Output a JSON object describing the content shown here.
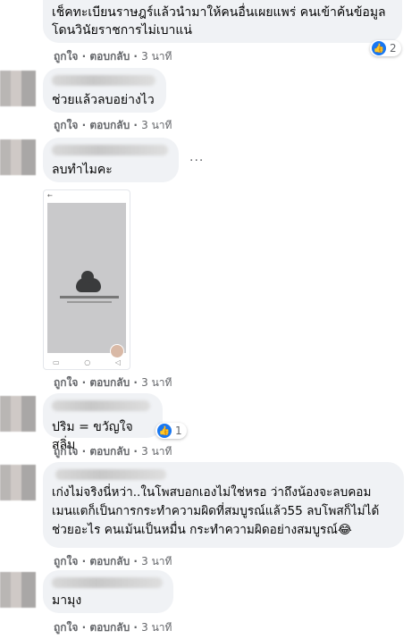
{
  "comments": [
    {
      "text": "เช็คทะเบียนราษฎร์แล้วนำมาให้คนอื่นเผยแพร่ คนเข้าค้นข้อมูล\nโดนวินัยราชการไม่เบาแน่",
      "like": "ถูกใจ",
      "reply": "ตอบกลับ",
      "time": "3 นาที",
      "reactions": "2"
    },
    {
      "text": "ช่วยแล้วลบอย่างไว",
      "like": "ถูกใจ",
      "reply": "ตอบกลับ",
      "time": "3 นาที"
    },
    {
      "text": "ลบทำไมคะ",
      "like": "ถูกใจ",
      "reply": "ตอบกลับ",
      "time": "3 นาที"
    },
    {
      "text": "ปริม = ขวัญใจสลิ่ม",
      "like": "ถูกใจ",
      "reply": "ตอบกลับ",
      "time": "3 นาที",
      "reactions": "1"
    },
    {
      "text": "เก่งไม่จริงนี่หว่า..ในโพสบอกเองไม่ใช่หรอ ว่าถึงน้องจะลบคอม\nเมนแตก็เป็นการกระทำความผิดที่สมบูรณ์แล้ว55 ลบโพสก็ไม่ได้\nช่วยอะไร คนเม้นเป็นหมื่น กระทำความผิดอย่างสมบูรณ์😂",
      "like": "ถูกใจ",
      "reply": "ตอบกลับ",
      "time": "3 นาที"
    },
    {
      "text": "มามุง",
      "like": "ถูกใจ",
      "reply": "ตอบกลับ",
      "time": "3 นาที"
    }
  ],
  "separator": "·",
  "more_label": "···",
  "accent": "#1877f2",
  "icons": [
    "thumbs-up-icon",
    "more-options-icon",
    "back-arrow-icon",
    "cloud-icon"
  ]
}
